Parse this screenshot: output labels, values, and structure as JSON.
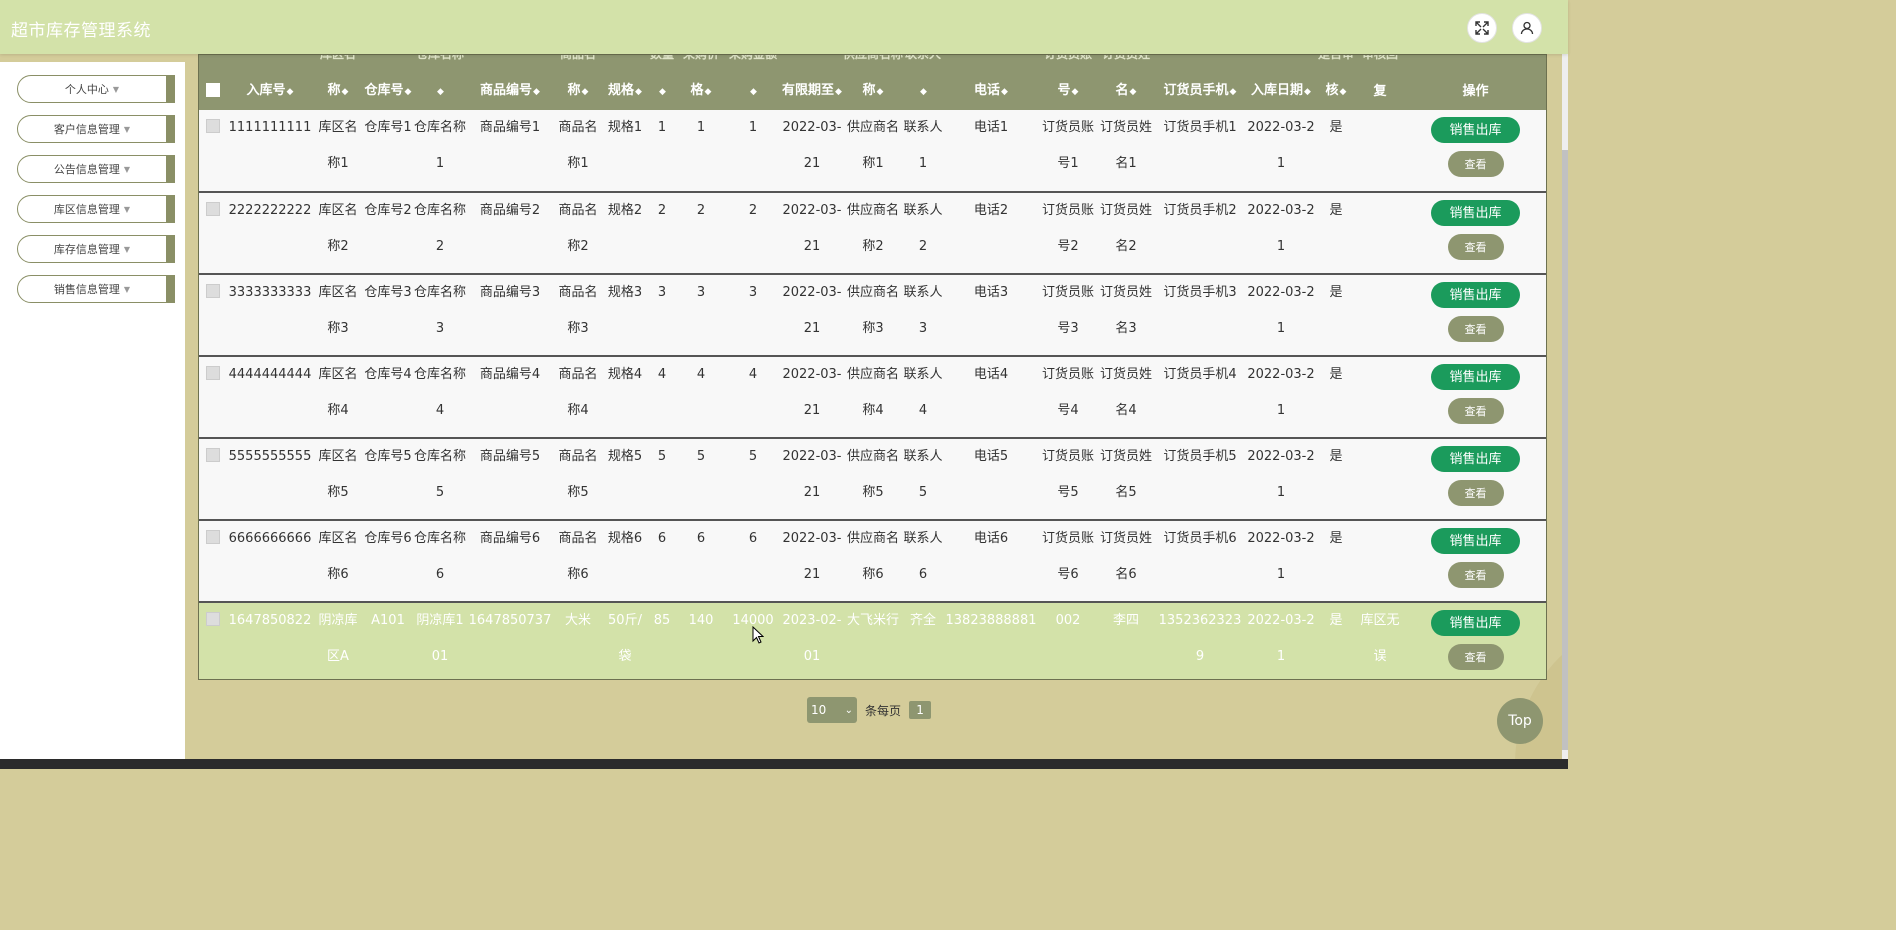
{
  "app": {
    "title": "超市库存管理系统"
  },
  "header": {
    "fullscreen_icon": "expand-icon",
    "user_icon": "user-icon"
  },
  "sidebar": {
    "items": [
      {
        "label": "个人中心"
      },
      {
        "label": "客户信息管理"
      },
      {
        "label": "公告信息管理"
      },
      {
        "label": "库区信息管理"
      },
      {
        "label": "库存信息管理"
      },
      {
        "label": "销售信息管理"
      }
    ]
  },
  "table": {
    "header_top": [
      "库区名",
      "仓库名称",
      "商品名",
      "数量",
      "采购价",
      "采购金额",
      "供应商名称",
      "联系人",
      "订货员账",
      "订货员姓",
      "是否审",
      "审核回"
    ],
    "columns": [
      "入库号",
      "称",
      "仓库号",
      "",
      "商品编号",
      "称",
      "规格",
      "",
      "格",
      "",
      "有限期至",
      "称",
      "",
      "电话",
      "号",
      "名",
      "订货员手机",
      "入库日期",
      "核",
      "复",
      "操作"
    ],
    "rows": [
      {
        "c": [
          "1111111111",
          "库区名称1",
          "仓库号1",
          "仓库名称1",
          "商品编号1",
          "商品名称1",
          "规格1",
          "1",
          "1",
          "1",
          "2022-03-21",
          "供应商名称1",
          "联系人1",
          "电话1",
          "订货员账号1",
          "订货员姓名1",
          "订货员手机1",
          "2022-03-21",
          "是",
          ""
        ]
      },
      {
        "c": [
          "2222222222",
          "库区名称2",
          "仓库号2",
          "仓库名称2",
          "商品编号2",
          "商品名称2",
          "规格2",
          "2",
          "2",
          "2",
          "2022-03-21",
          "供应商名称2",
          "联系人2",
          "电话2",
          "订货员账号2",
          "订货员姓名2",
          "订货员手机2",
          "2022-03-21",
          "是",
          ""
        ]
      },
      {
        "c": [
          "3333333333",
          "库区名称3",
          "仓库号3",
          "仓库名称3",
          "商品编号3",
          "商品名称3",
          "规格3",
          "3",
          "3",
          "3",
          "2022-03-21",
          "供应商名称3",
          "联系人3",
          "电话3",
          "订货员账号3",
          "订货员姓名3",
          "订货员手机3",
          "2022-03-21",
          "是",
          ""
        ]
      },
      {
        "c": [
          "4444444444",
          "库区名称4",
          "仓库号4",
          "仓库名称4",
          "商品编号4",
          "商品名称4",
          "规格4",
          "4",
          "4",
          "4",
          "2022-03-21",
          "供应商名称4",
          "联系人4",
          "电话4",
          "订货员账号4",
          "订货员姓名4",
          "订货员手机4",
          "2022-03-21",
          "是",
          ""
        ]
      },
      {
        "c": [
          "5555555555",
          "库区名称5",
          "仓库号5",
          "仓库名称5",
          "商品编号5",
          "商品名称5",
          "规格5",
          "5",
          "5",
          "5",
          "2022-03-21",
          "供应商名称5",
          "联系人5",
          "电话5",
          "订货员账号5",
          "订货员姓名5",
          "订货员手机5",
          "2022-03-21",
          "是",
          ""
        ]
      },
      {
        "c": [
          "6666666666",
          "库区名称6",
          "仓库号6",
          "仓库名称6",
          "商品编号6",
          "商品名称6",
          "规格6",
          "6",
          "6",
          "6",
          "2022-03-21",
          "供应商名称6",
          "联系人6",
          "电话6",
          "订货员账号6",
          "订货员姓名6",
          "订货员手机6",
          "2022-03-21",
          "是",
          ""
        ]
      },
      {
        "c": [
          "1647850822",
          "阴凉库区A",
          "A101",
          "阴凉库101",
          "1647850737",
          "大米",
          "50斤/袋",
          "85",
          "140",
          "14000",
          "2023-02-01",
          "大飞米行",
          "齐全",
          "13823888881",
          "002",
          "李四",
          "13523623239",
          "2022-03-21",
          "是",
          "库区无误"
        ],
        "highlight": true
      }
    ],
    "sale_label": "销售出库",
    "view_label": "查看"
  },
  "pagination": {
    "page_size": "10",
    "per_page_label": "条每页",
    "current_page": "1"
  },
  "top_button": "Top"
}
